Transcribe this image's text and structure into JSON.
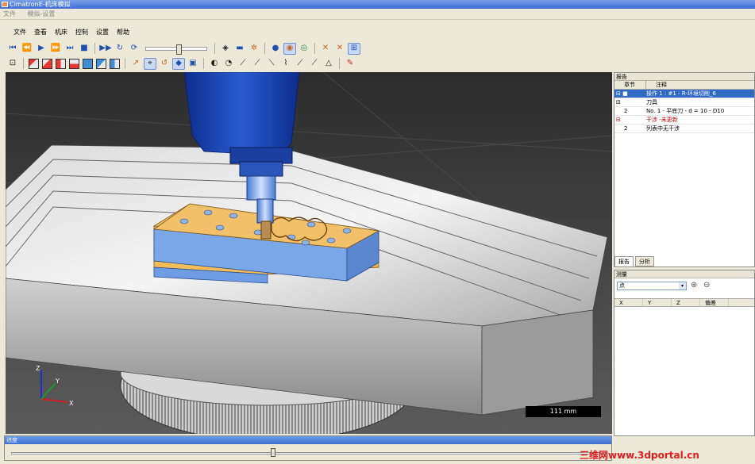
{
  "window": {
    "title": "CimatronE-机床模拟",
    "outer_menu": [
      "文件",
      "模拟-设置"
    ]
  },
  "menubar": [
    "文件",
    "查看",
    "机床",
    "控制",
    "设置",
    "帮助"
  ],
  "toolbar1": {
    "icons": [
      "first-icon",
      "prev-icon",
      "play-icon",
      "next-icon",
      "last-icon",
      "stop-icon",
      "fast-forward-icon",
      "refresh-icon",
      "loop-icon",
      "speed-slider",
      "view-icon",
      "tool-icon",
      "settings-icon",
      "globe-icon",
      "globe-active-icon",
      "globe-alt-icon",
      "split-icon",
      "split2-icon",
      "fit-icon"
    ]
  },
  "toolbar2": {
    "icons": [
      "fit-view-icon",
      "cube-iso-icon",
      "cube-front-icon",
      "cube-back-icon",
      "cube-left-icon",
      "cube-right-icon",
      "cube-top-icon",
      "cube-bottom-icon",
      "path-icon",
      "tool-display-icon",
      "rotate-icon",
      "machine-icon",
      "stock-icon",
      "shading-icon",
      "tool-holder-icon",
      "tool-path-icon",
      "collision-icon",
      "trace-icon",
      "axis-icon",
      "cut-icon",
      "gouge-icon",
      "color-icon",
      "pin-icon"
    ]
  },
  "viewport": {
    "scale_label": "111 mm",
    "axis_labels": {
      "x": "X",
      "y": "Y",
      "z": "Z"
    }
  },
  "report": {
    "title": "报告",
    "columns": [
      "章节",
      "注释"
    ],
    "rows": [
      {
        "id": "",
        "text": "操作 1 : #1 - R-环境切削_6",
        "selected": true,
        "group": true
      },
      {
        "id": "",
        "text": "刀具",
        "group": true
      },
      {
        "id": "2",
        "text": "No. 1 - 平底刀 - d = 10 - D10"
      },
      {
        "id": "",
        "text": "干涉 -未更新",
        "group": true,
        "warn": true
      },
      {
        "id": "2",
        "text": "列表中无干涉"
      }
    ],
    "tabs": [
      "报告",
      "分析"
    ]
  },
  "measure": {
    "title": "测量",
    "select_value": "点",
    "columns": [
      "X",
      "Y",
      "Z",
      "偏差"
    ]
  },
  "progress": {
    "title": "进度",
    "value_fraction": 0.44
  },
  "watermark": "三维网www.3dportal.cn",
  "colors": {
    "selection": "#316ac5",
    "spindle": "#1f4fb3",
    "stock": "#e7b95c",
    "fixture": "#7aa7e8",
    "watermark": "#e31c1c"
  }
}
